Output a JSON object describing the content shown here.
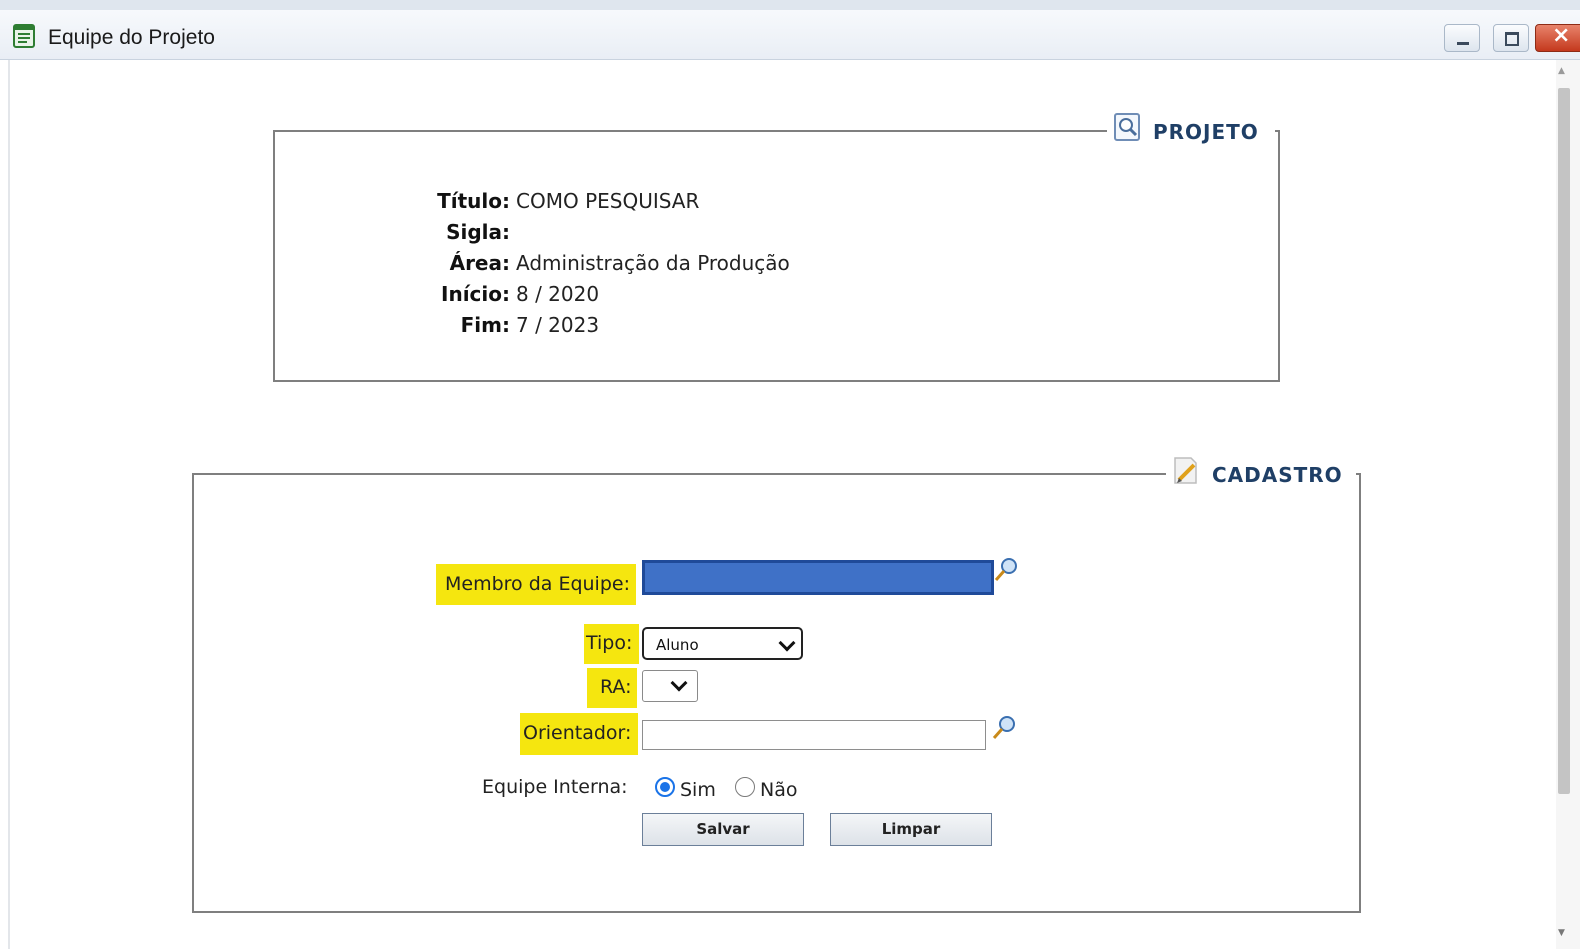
{
  "window": {
    "title": "Equipe do Projeto",
    "icon": "document-list-icon",
    "minimize_glyph": "",
    "close_glyph": "×"
  },
  "projeto": {
    "legend": "PROJETO",
    "legend_icon": "magnifier-icon",
    "fields": [
      {
        "label": "Título:",
        "value": "COMO PESQUISAR"
      },
      {
        "label": "Sigla:",
        "value": ""
      },
      {
        "label": "Área:",
        "value": "Administração da Produção"
      },
      {
        "label": "Início:",
        "value": "8 / 2020"
      },
      {
        "label": "Fim:",
        "value": "7 / 2023"
      }
    ]
  },
  "cadastro": {
    "legend": "CADASTRO",
    "legend_icon": "edit-document-icon",
    "membro_label": "Membro da Equipe:",
    "membro_value": "",
    "tipo_label": "Tipo:",
    "tipo_selected": "Aluno",
    "ra_label": "RA:",
    "ra_selected": "",
    "orientador_label": "Orientador:",
    "orientador_value": "",
    "equipe_interna_label": "Equipe Interna:",
    "option_sim": "Sim",
    "option_nao": "Não",
    "selected_option": "Sim",
    "save_label": "Salvar",
    "clear_label": "Limpar"
  },
  "colors": {
    "highlight": "#f5e60f",
    "legend_text": "#1f3f66",
    "masked_field": "#3f71c7",
    "radio_selected": "#1a73e8"
  }
}
